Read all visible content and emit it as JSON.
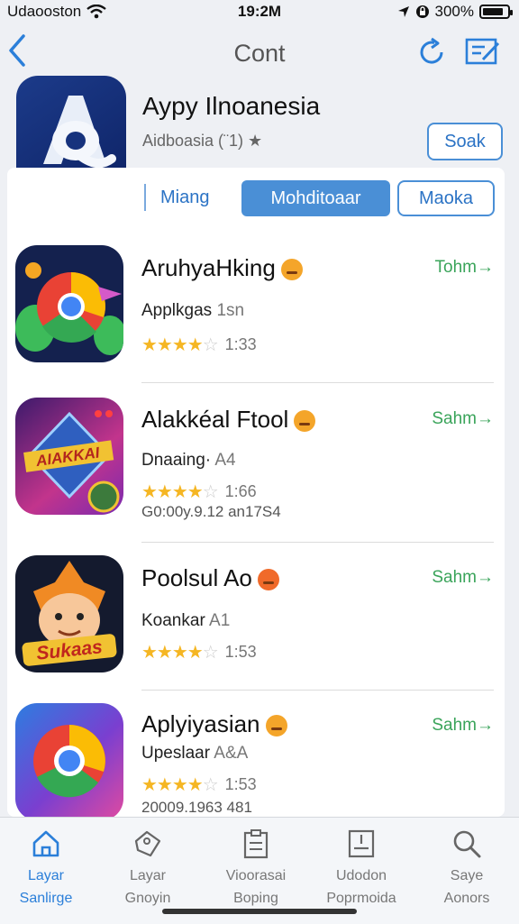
{
  "status_bar": {
    "carrier": "Udaooston",
    "time": "19:2M",
    "battery": "300%"
  },
  "nav": {
    "title": "Cont",
    "back_icon": "chevron-left-icon",
    "refresh_icon": "refresh-icon",
    "edit_icon": "edit-list-icon"
  },
  "featured": {
    "title": "Aypy Ilnoanesia",
    "subtitle": "Aidboasia (¨1) ★",
    "action_label": "Soak",
    "segments": [
      "Miang",
      "Mohditoaar",
      "Maoka"
    ],
    "selected_segment": 1
  },
  "apps": [
    {
      "title": "AruhyaHking",
      "subtitle": "Applkgas",
      "subtitle_extra": "1sn",
      "stars": 4.5,
      "rating_text": "1:33",
      "extra": "",
      "action": "Tohm→"
    },
    {
      "title": "Alakkéal Ftool",
      "subtitle": "Dnaaing·",
      "subtitle_extra": "A4",
      "stars": 4.5,
      "rating_text": "1:66",
      "extra": "G0:00y.9.12  an17S4",
      "action": "Sahm→",
      "icon_text": "AIAKKAI"
    },
    {
      "title": "Poolsul Ao",
      "subtitle": "Koankar",
      "subtitle_extra": "A1",
      "stars": 4.5,
      "rating_text": "1:53",
      "extra": "",
      "action": "Sahm→",
      "icon_text": "Sukaas"
    },
    {
      "title": "Aplyiyasian",
      "subtitle": "Upeslaar",
      "subtitle_extra": "A&A",
      "stars": 4.5,
      "rating_text": "1:53",
      "extra": "20009.1963  481",
      "action": "Sahm→"
    }
  ],
  "tabs": [
    {
      "line1": "Layar",
      "line2": "Sanlirge",
      "icon": "home-icon",
      "active": true
    },
    {
      "line1": "Layar",
      "line2": "Gnoyin",
      "icon": "tag-icon",
      "active": false
    },
    {
      "line1": "Vioorasai",
      "line2": "Boping",
      "icon": "clipboard-icon",
      "active": false
    },
    {
      "line1": "Udodon",
      "line2": "Poprmoida",
      "icon": "update-icon",
      "active": false
    },
    {
      "line1": "Saye",
      "line2": "Aonors",
      "icon": "search-icon",
      "active": false
    }
  ],
  "colors": {
    "accent": "#4a8fd6",
    "get_green": "#3aa45a",
    "star": "#f5b623"
  }
}
